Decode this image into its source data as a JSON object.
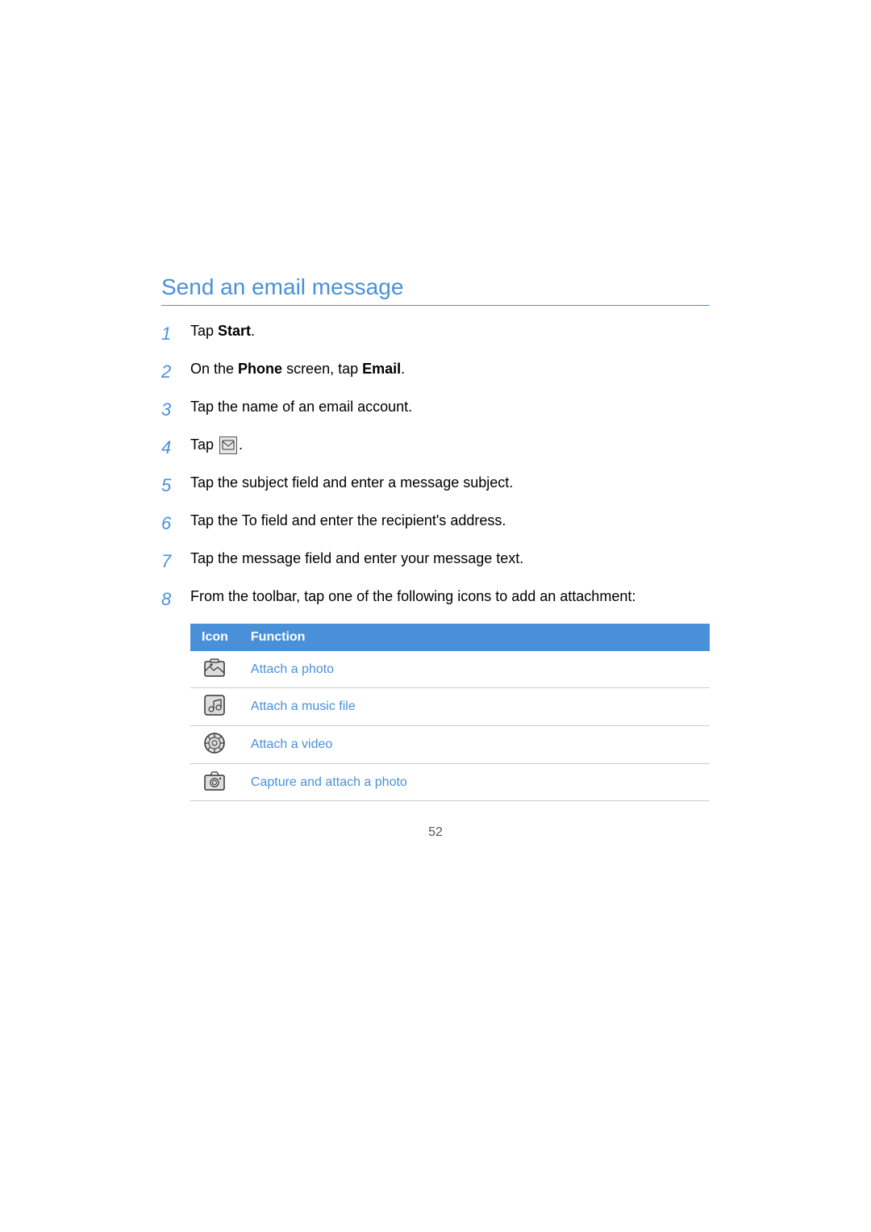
{
  "page": {
    "title": "Send an email message",
    "page_number": "52"
  },
  "steps": [
    {
      "number": "1",
      "text": "Tap ",
      "bold": "Start",
      "after": ".",
      "type": "bold_word"
    },
    {
      "number": "2",
      "text": "On the ",
      "bold1": "Phone",
      "mid": " screen, tap ",
      "bold2": "Email",
      "after": ".",
      "type": "two_bold"
    },
    {
      "number": "3",
      "text": "Tap the name of an email account.",
      "type": "plain"
    },
    {
      "number": "4",
      "text": "Tap ",
      "after": ".",
      "type": "icon_inline"
    },
    {
      "number": "5",
      "text": "Tap the subject field and enter a message subject.",
      "type": "plain"
    },
    {
      "number": "6",
      "text": "Tap the To field and enter the recipient's address.",
      "type": "plain"
    },
    {
      "number": "7",
      "text": "Tap the message field and enter your message text.",
      "type": "plain"
    },
    {
      "number": "8",
      "text": "From the toolbar, tap one of the following icons to add an attachment:",
      "type": "plain"
    }
  ],
  "table": {
    "header": {
      "col1": "Icon",
      "col2": "Function"
    },
    "rows": [
      {
        "icon_type": "photo",
        "function": "Attach a photo"
      },
      {
        "icon_type": "music",
        "function": "Attach a music file"
      },
      {
        "icon_type": "video",
        "function": "Attach a video"
      },
      {
        "icon_type": "camera",
        "function": "Capture and attach a photo"
      }
    ]
  }
}
